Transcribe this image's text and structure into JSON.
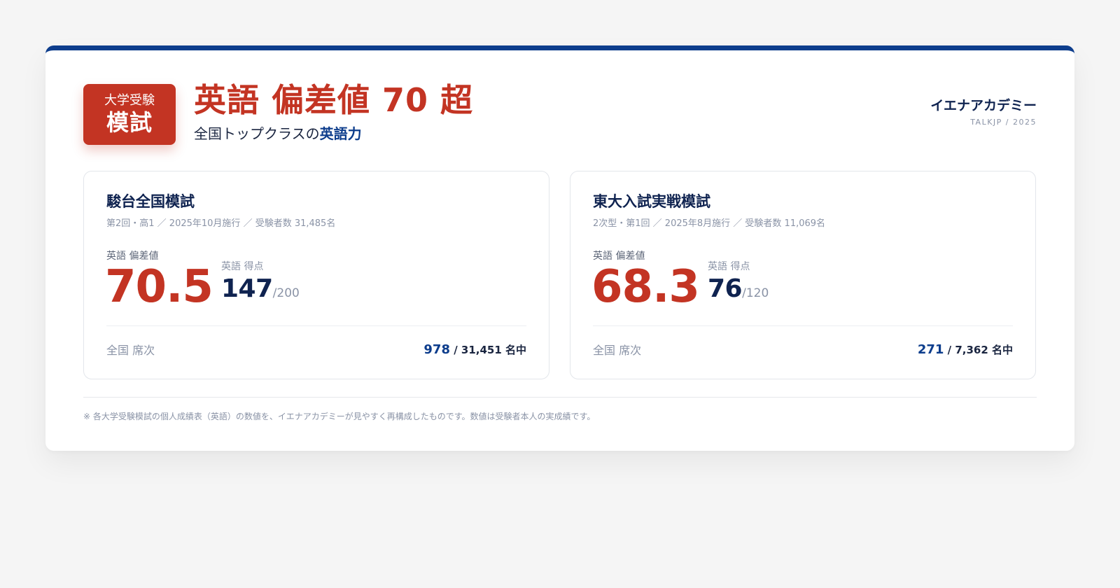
{
  "badge": {
    "top": "大学受験",
    "main": "模試"
  },
  "header": {
    "headline": "英語 偏差値 70 超",
    "subline_prefix": "全国トップクラスの",
    "subline_accent": "英語力",
    "brand": "イエナアカデミー",
    "brand_sub": "TALKJP / 2025"
  },
  "results": [
    {
      "title": "駿台全国模試",
      "meta": "第2回・高1 ／ 2025年10月施行 ／ 受験者数 31,485名",
      "deviation_label": "英語 偏差値",
      "deviation": "70.5",
      "score_label": "英語 得点",
      "score": "147",
      "score_max": "/200",
      "rank_label": "全国 席次",
      "rank": "978",
      "rank_total": " / 31,451 名中"
    },
    {
      "title": "東大入試実戦模試",
      "meta": "2次型・第1回 ／ 2025年8月施行 ／ 受験者数 11,069名",
      "deviation_label": "英語 偏差値",
      "deviation": "68.3",
      "score_label": "英語 得点",
      "score": "76",
      "score_max": "/120",
      "rank_label": "全国 席次",
      "rank": "271",
      "rank_total": " / 7,362 名中"
    }
  ],
  "footnote": "※ 各大学受験模試の個人成績表（英語）の数値を、イエナアカデミーが見やすく再構成したものです。数値は受験者本人の実成績です。",
  "colors": {
    "accent_red": "#c33423",
    "navy": "#0d3d8c",
    "text_dark": "#0f2350",
    "muted": "#8a93a6"
  }
}
